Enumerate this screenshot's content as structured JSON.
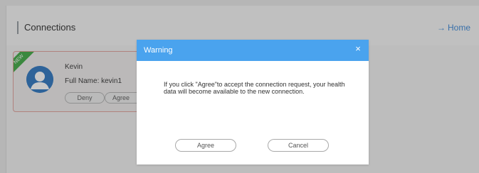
{
  "header": {
    "title": "Connections",
    "home_link": "Home"
  },
  "card": {
    "ribbon_text": "NEW",
    "name": "Kevin",
    "full_name": "Full Name: kevin1",
    "deny_label": "Deny",
    "agree_label": "Agree"
  },
  "modal": {
    "title": "Warning",
    "close_glyph": "×",
    "message": "If you click \"Agree\"to accept the connection request, your health data will become available to the new connection.",
    "agree_label": "Agree",
    "cancel_label": "Cancel"
  },
  "colors": {
    "accent": "#4aa3ee",
    "link": "#4a90d9",
    "avatar": "#3b7fc4",
    "ribbon": "#4caf50",
    "card_border": "#e2a7a0"
  },
  "icons": {
    "home": "arrow-right-icon",
    "avatar": "user-avatar-icon",
    "close": "close-icon"
  }
}
